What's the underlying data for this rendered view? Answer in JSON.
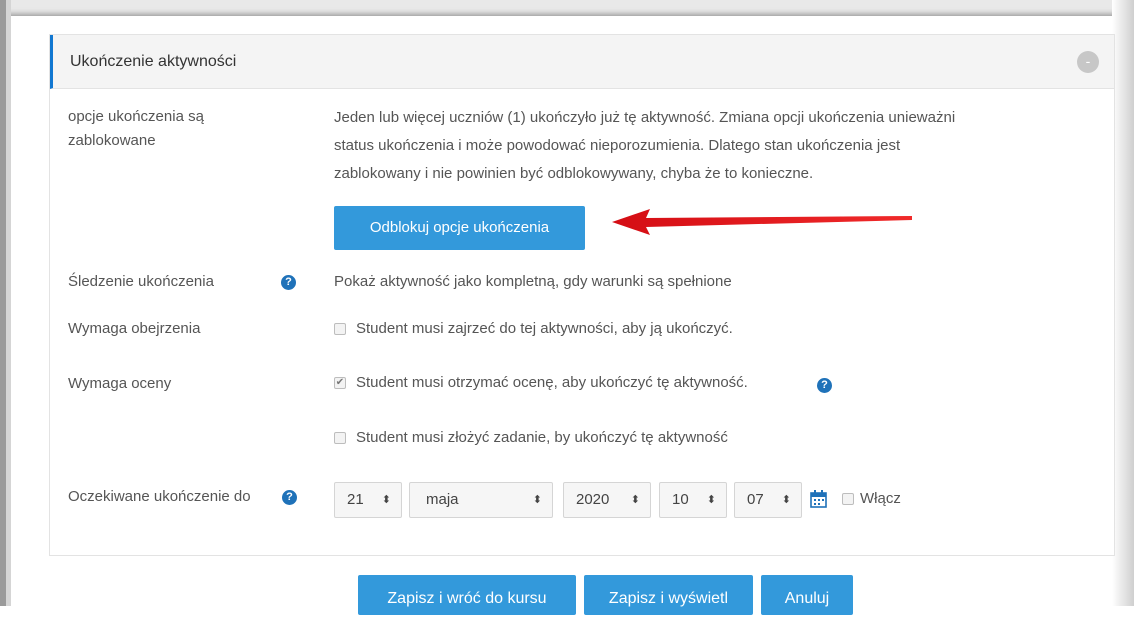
{
  "section": {
    "title": "Ukończenie aktywności",
    "collapse_icon": "-"
  },
  "locked": {
    "label_line1": "opcje ukończenia są",
    "label_line2": "zablokowane",
    "text_line1": "Jeden lub więcej uczniów (1) ukończyło już tę aktywność. Zmiana opcji ukończenia unieważni",
    "text_line2": "status ukończenia i może powodować nieporozumienia. Dlatego stan ukończenia jest",
    "text_line3": "zablokowany i nie powinien być odblokowywany, chyba że to konieczne.",
    "unlock_button": "Odblokuj opcje ukończenia"
  },
  "tracking": {
    "label": "Śledzenie ukończenia",
    "value": "Pokaż aktywność jako kompletną, gdy warunki są spełnione"
  },
  "view": {
    "label": "Wymaga obejrzenia",
    "checkbox_text": "Student musi zajrzeć do tej aktywności, aby ją ukończyć.",
    "checked": false
  },
  "grade": {
    "label": "Wymaga oceny",
    "checkbox_text": "Student musi otrzymać ocenę, aby ukończyć tę aktywność.",
    "checked": true
  },
  "submit": {
    "checkbox_text": "Student musi złożyć zadanie, by ukończyć tę aktywność",
    "checked": false
  },
  "expected": {
    "label": "Oczekiwane ukończenie do",
    "day": "21",
    "month": "maja",
    "year": "2020",
    "hour": "10",
    "minute": "07",
    "enable_label": "Włącz",
    "enabled": false
  },
  "footer": {
    "save_return": "Zapisz i wróć do kursu",
    "save_display": "Zapisz i wyświetl",
    "cancel": "Anuluj"
  },
  "icons": {
    "help": "?",
    "check": "✔",
    "select_arrow": "⬍",
    "calendar": "calendar-icon"
  },
  "colors": {
    "primary": "#3399db",
    "help": "#1f72b9",
    "header_accent": "#1177d1",
    "arrow": "#e8141b"
  }
}
